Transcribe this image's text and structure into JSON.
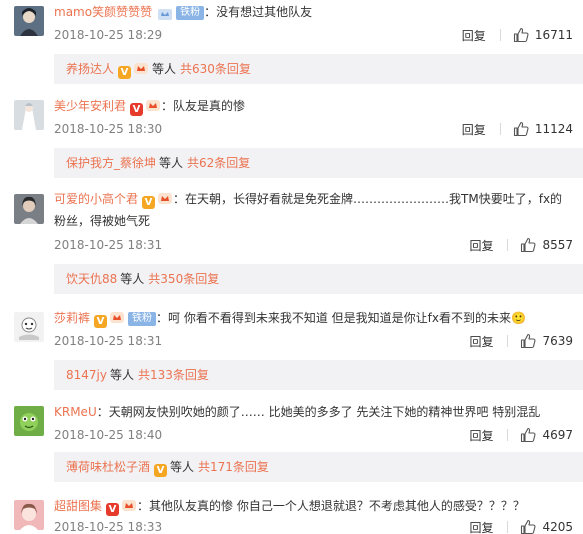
{
  "comments": [
    {
      "user": "mamo笑颜赞赞赞",
      "badges": [
        "fan"
      ],
      "fan_badge": "铁粉",
      "sep": "：",
      "text": "没有想过其他队友",
      "time": "2018-10-25 18:29",
      "reply_label": "回复",
      "likes": "16711",
      "avatar_color": "#5d6f83",
      "sub": {
        "user": "养扬达人",
        "has_v": true,
        "has_crown": true,
        "etc": "等人",
        "total": "共630条回复"
      }
    },
    {
      "user": "美少年安利君",
      "sep": "：",
      "text": "队友是真的惨",
      "time": "2018-10-25 18:30",
      "reply_label": "回复",
      "likes": "11124",
      "avatar_color": "#d8dde2",
      "sub": {
        "user": "保护我方_蔡徐坤",
        "etc": "等人",
        "total": "共62条回复"
      }
    },
    {
      "user": "可爱的小高个君",
      "sep": "：",
      "text": "在天朝，长得好看就是免死金牌……………………我TM快要吐了，fx的粉丝，得被她气死",
      "time": "2018-10-25 18:31",
      "reply_label": "回复",
      "likes": "8557",
      "avatar_color": "#7a7f86",
      "sub": {
        "user": "饮天仇88",
        "etc": "等人",
        "total": "共350条回复"
      }
    },
    {
      "user": "莎莉裤",
      "fan_badge": "铁粉",
      "sep": "：",
      "text": "呵 你看不看得到未来我不知道 但是我知道是你让fx看不到的未来",
      "emoji": "🙂",
      "time": "2018-10-25 18:31",
      "reply_label": "回复",
      "likes": "7639",
      "avatar_color": "#e8e8e8",
      "sub": {
        "user": "8147jy",
        "etc": "等人",
        "total": "共133条回复"
      }
    },
    {
      "user": "KRMeU",
      "sep": "：",
      "text": "天朝网友快别吹她的颜了…… 比她美的多多了 先关注下她的精神世界吧 特别混乱",
      "time": "2018-10-25 18:40",
      "reply_label": "回复",
      "likes": "4697",
      "avatar_color": "#6fae47",
      "sub": {
        "user": "薄荷味杜松子酒",
        "has_v": true,
        "etc": "等人",
        "total": "共171条回复"
      }
    },
    {
      "user": "超甜图集",
      "sep": "：",
      "text": "其他队友真的惨 你自己一个人想退就退？不考虑其他人的感受？？？？",
      "time": "2018-10-25 18:33",
      "reply_label": "回复",
      "likes": "4205",
      "avatar_color": "#f0b8b8"
    }
  ]
}
